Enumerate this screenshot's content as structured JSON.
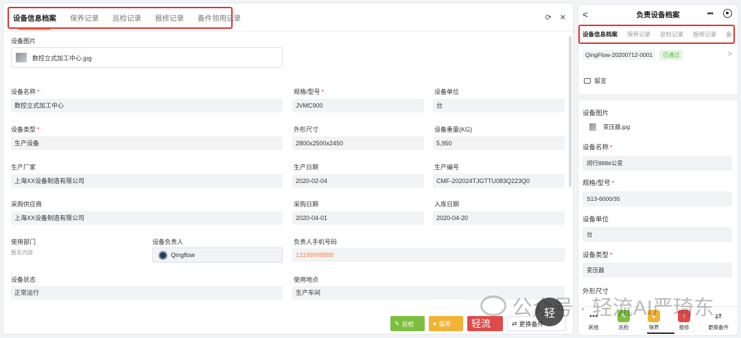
{
  "desktop": {
    "tabs": [
      "设备信息档案",
      "保养记录",
      "巡检记录",
      "报修记录",
      "备件领用记录"
    ],
    "controls": {
      "refresh": "⟳",
      "close": "✕"
    },
    "image_label": "设备图片",
    "image_file": "数控立式加工中心.jpg",
    "fields": {
      "name_label": "设备名称",
      "name_value": "数控立式加工中心",
      "model_label": "规格/型号",
      "model_value": "JVMC900",
      "unit_label": "设备单位",
      "unit_value": "台",
      "type_label": "设备类型",
      "type_value": "生产设备",
      "size_label": "外形尺寸",
      "size_value": "2800x2500x2450",
      "weight_label": "设备重量(KG)",
      "weight_value": "5,950",
      "maker_label": "生产厂家",
      "maker_value": "上海XX设备制造有限公司",
      "mdate_label": "生产日期",
      "mdate_value": "2020-02-04",
      "serial_label": "生产编号",
      "serial_value": "CMF-202024TJGTTU083Q223Q0",
      "supplier_label": "采购供应商",
      "supplier_value": "上海XX设备制造有限公司",
      "pdate_label": "采购日期",
      "pdate_value": "2020-04-01",
      "indate_label": "入库日期",
      "indate_value": "2020-04-20",
      "dept_label": "使用部门",
      "dept_value": "暂无内容",
      "owner_label": "设备负责人",
      "owner_value": "Qingflow",
      "phone_label": "负责人手机号码",
      "phone_value": "13199998888",
      "status_label": "设备状态",
      "status_value": "正常运行",
      "place_label": "使用地点",
      "place_value": "生产车间"
    },
    "buttons": {
      "inspect": "巡检",
      "maintain": "保养",
      "repair": "轻流",
      "spare": "更换备件"
    }
  },
  "mobile": {
    "title": "负责设备档案",
    "back": "<",
    "more": "•••",
    "tabs": [
      "设备信息档案",
      "保养记录",
      "巡检记录",
      "报修记录",
      "备"
    ],
    "record_id": "QingFlow-20200712-0001",
    "record_status": "已通过",
    "chevron": ">",
    "comment": "留言",
    "image_label": "设备图片",
    "image_file": "变压器.jpg",
    "name_label": "设备名称",
    "name_value": "闵行888#公变",
    "model_label": "规格/型号",
    "model_value": "S13-6000/35",
    "unit_label": "设备单位",
    "unit_value": "台",
    "type_label": "设备类型",
    "type_value": "变压器",
    "size_label": "外形尺寸",
    "footer": [
      "其他",
      "巡检",
      "保养",
      "报修",
      "更换备件"
    ]
  },
  "watermark": {
    "text": "公众号 · 轻流AI严琦东",
    "badge": "轻"
  },
  "required_mark": "*"
}
